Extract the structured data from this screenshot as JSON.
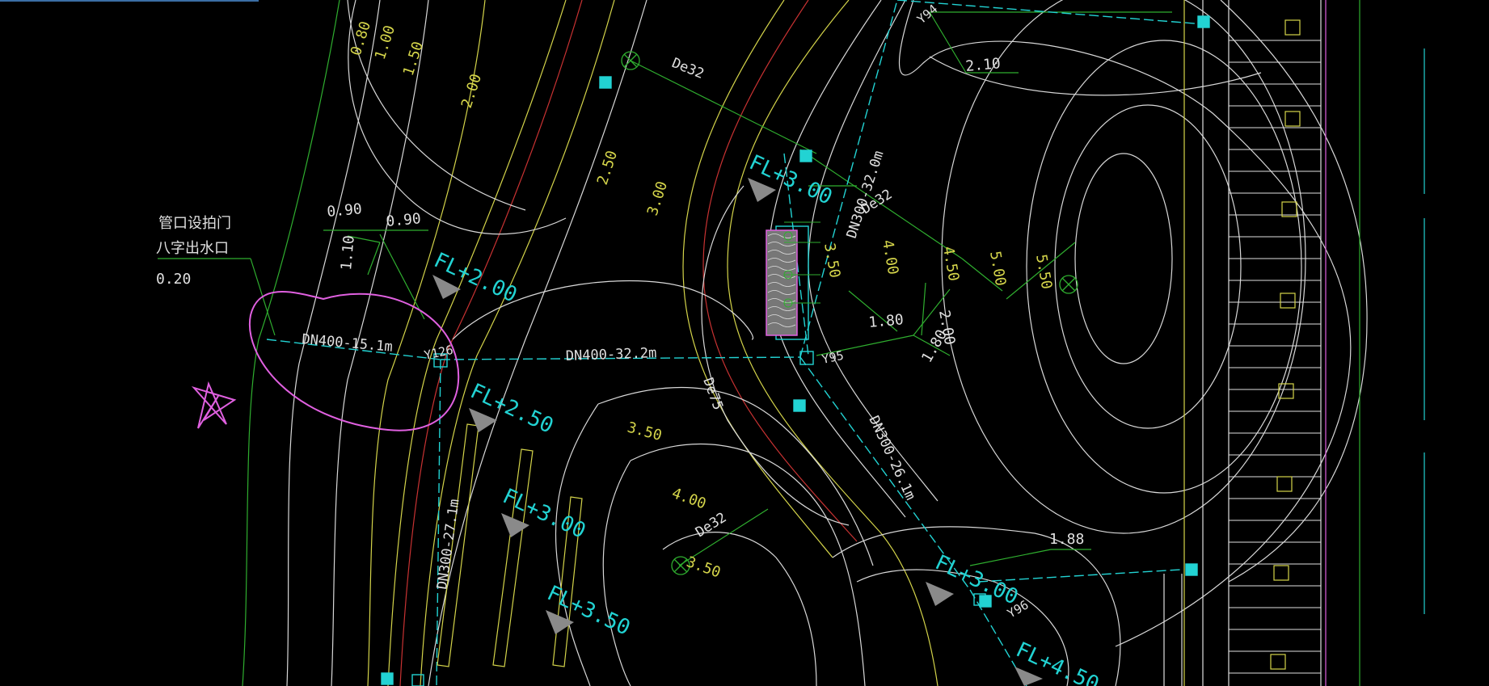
{
  "note": {
    "line1": "管口设拍门",
    "line2": "八字出水口",
    "value": "0.20"
  },
  "pipes": {
    "dn400_15": "DN400-15.1m",
    "dn400_32": "DN400-32.2m",
    "dn300_32": "DN300-32.0m",
    "dn300_26": "DN300-26.1m",
    "dn300_27": "DN300-27.1m",
    "de32_a": "De32",
    "de32_b": "De32",
    "de32_c": "De32",
    "de75": "De75"
  },
  "nodes": {
    "y126": "Y126",
    "y95": "Y95",
    "y94": "Y94",
    "y96": "Y96"
  },
  "floor_levels": {
    "fl_200": "FL+2.00",
    "fl_250": "FL+2.50",
    "fl_300_a": "FL+3.00",
    "fl_300_b": "FL+3.00",
    "fl_350": "FL+3.50",
    "fl_300_c": "FL+3.00",
    "fl_450": "FL+4.50"
  },
  "contour_labels": {
    "c080": "0.80",
    "c100": "1.00",
    "c150": "1.50",
    "c200": "2.00",
    "c250": "2.50",
    "c300": "3.00",
    "c350a": "3.50",
    "c400a": "4.00",
    "c350b": "3.50",
    "c350c": "3.50",
    "c400b": "4.00",
    "c450": "4.50",
    "c500": "5.00",
    "c550": "5.50"
  },
  "dimensions": {
    "d090a": "0.90",
    "d090b": "0.90",
    "d110": "1.10",
    "d210": "2.10",
    "d180a": "1.80",
    "d180b": "1.80",
    "d200": "2.00",
    "d188": "1.88"
  },
  "colors": {
    "background": "#000000",
    "contour": "#d8d8d8",
    "road": "#d4d44a",
    "curb": "#c83232",
    "green_line": "#2fae2f",
    "cyan": "#22d3d3",
    "magenta_markup": "#e060e0",
    "wall": "#e0e0e0"
  }
}
